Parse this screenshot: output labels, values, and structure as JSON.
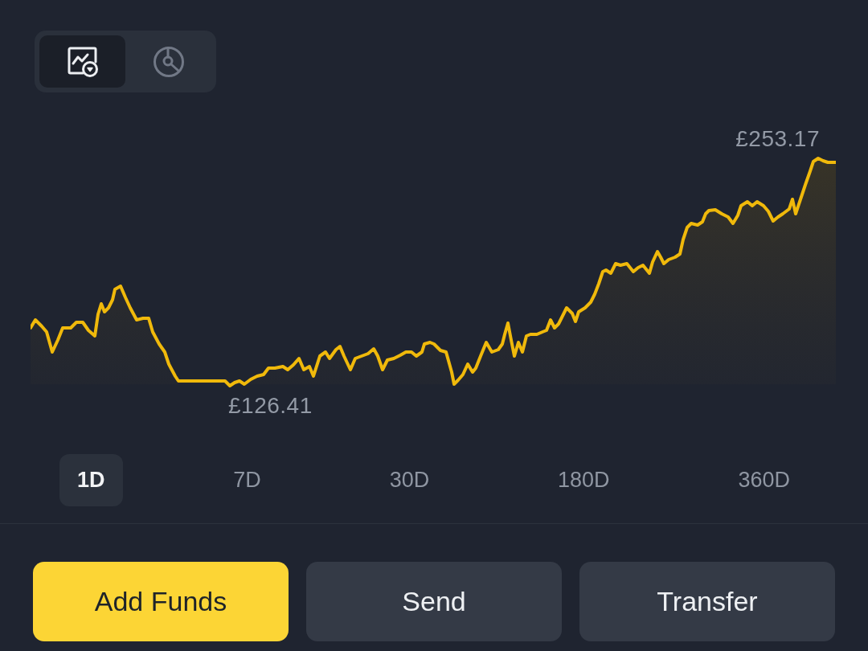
{
  "view_toggle": [
    {
      "kind": "chart",
      "selected": true
    },
    {
      "kind": "dial",
      "selected": false
    }
  ],
  "chart": {
    "high_label": "£253.17",
    "low_label": "£126.41"
  },
  "periods": [
    {
      "label": "1D",
      "selected": true
    },
    {
      "label": "7D",
      "selected": false
    },
    {
      "label": "30D",
      "selected": false
    },
    {
      "label": "180D",
      "selected": false
    },
    {
      "label": "360D",
      "selected": false
    }
  ],
  "actions": [
    {
      "label": "Add Funds",
      "kind": "primary"
    },
    {
      "label": "Send",
      "kind": "secondary"
    },
    {
      "label": "Transfer",
      "kind": "secondary"
    }
  ]
}
